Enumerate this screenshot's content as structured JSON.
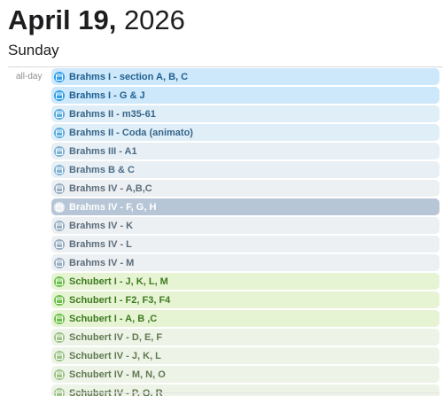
{
  "header": {
    "date_bold": "April 19,",
    "year": " 2026",
    "weekday": "Sunday"
  },
  "allday_label": "all-day",
  "events": [
    {
      "title": "Brahms I - section A, B, C",
      "bg": "#cde8fb",
      "icon": "#2f9ee8",
      "text": "#1f5f8f"
    },
    {
      "title": "Brahms I - G & J",
      "bg": "#cde8fb",
      "icon": "#2f9ee8",
      "text": "#1f5f8f"
    },
    {
      "title": "Brahms II - m35-61",
      "bg": "#e0eef8",
      "icon": "#5aabdf",
      "text": "#35668a"
    },
    {
      "title": "Brahms II - Coda (animato)",
      "bg": "#e0eef8",
      "icon": "#5aabdf",
      "text": "#35668a"
    },
    {
      "title": "Brahms III - A1",
      "bg": "#e8eff5",
      "icon": "#7fb3d6",
      "text": "#4d6d86"
    },
    {
      "title": "Brahms B & C",
      "bg": "#e8eff5",
      "icon": "#7fb3d6",
      "text": "#4d6d86"
    },
    {
      "title": "Brahms IV - A,B,C",
      "bg": "#edf0f3",
      "icon": "#98aec2",
      "text": "#5b6c7b"
    },
    {
      "title": "Brahms IV - F, G, H",
      "bg": "#b7c6d6",
      "icon": "#e9eef3",
      "text": "#ffffff"
    },
    {
      "title": "Brahms IV - K",
      "bg": "#edf0f3",
      "icon": "#98aec2",
      "text": "#5b6c7b"
    },
    {
      "title": "Brahms IV - L",
      "bg": "#edf0f3",
      "icon": "#98aec2",
      "text": "#5b6c7b"
    },
    {
      "title": "Brahms IV - M",
      "bg": "#edf0f3",
      "icon": "#98aec2",
      "text": "#5b6c7b"
    },
    {
      "title": "Schubert I - J, K, L, M",
      "bg": "#e6f4d4",
      "icon": "#6cc04a",
      "text": "#3f7a1f"
    },
    {
      "title": "Schubert I - F2, F3, F4",
      "bg": "#e6f4d4",
      "icon": "#6cc04a",
      "text": "#3f7a1f"
    },
    {
      "title": "Schubert I - A, B ,C",
      "bg": "#e6f4d4",
      "icon": "#6cc04a",
      "text": "#3f7a1f"
    },
    {
      "title": "Schubert IV - D, E, F",
      "bg": "#eef3e8",
      "icon": "#9cc487",
      "text": "#5f7a50"
    },
    {
      "title": "Schubert IV - J, K, L",
      "bg": "#eef3e8",
      "icon": "#9cc487",
      "text": "#5f7a50"
    },
    {
      "title": "Schubert IV - M, N, O",
      "bg": "#eef3e8",
      "icon": "#9cc487",
      "text": "#5f7a50"
    },
    {
      "title": "Schubert IV - P, Q, R",
      "bg": "#eef3e8",
      "icon": "#9cc487",
      "text": "#5f7a50"
    }
  ]
}
